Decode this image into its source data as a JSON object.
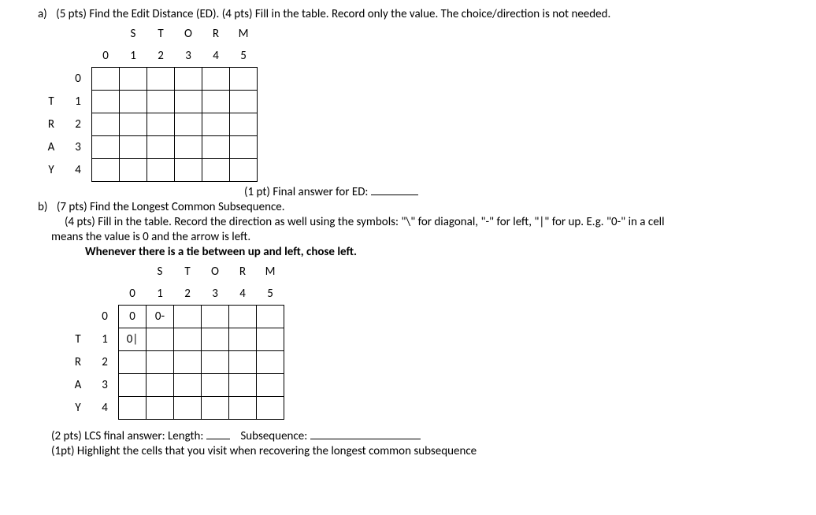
{
  "partA": {
    "label": "a)",
    "prompt": "(5 pts) Find the Edit Distance (ED). (4 pts) Fill in the table. Record only the value. The choice/direction is not needed.",
    "colLetters": [
      "S",
      "T",
      "O",
      "R",
      "M"
    ],
    "colNums": [
      "0",
      "1",
      "2",
      "3",
      "4",
      "5"
    ],
    "rowLetters": [
      "",
      "T",
      "R",
      "A",
      "Y"
    ],
    "rowNums": [
      "0",
      "1",
      "2",
      "3",
      "4"
    ],
    "cells": [
      [
        "",
        "",
        "",
        "",
        "",
        ""
      ],
      [
        "",
        "",
        "",
        "",
        "",
        ""
      ],
      [
        "",
        "",
        "",
        "",
        "",
        ""
      ],
      [
        "",
        "",
        "",
        "",
        "",
        ""
      ],
      [
        "",
        "",
        "",
        "",
        "",
        ""
      ]
    ],
    "finalLabel": "(1 pt) Final answer for ED:"
  },
  "partB": {
    "label": "b)",
    "prompt": "(7 pts) Find the Longest Common Subsequence.",
    "line2a": "(4 pts) Fill in the table. Record the direction as well using the symbols: \"\\\" for diagonal, \"-\" for left, \"|\" for up. E.g. \"0-\" in a cell",
    "line2b": "means the value is 0 and the arrow is left.",
    "rule": "Whenever there is a tie between up and left, chose left.",
    "colLetters": [
      "S",
      "T",
      "O",
      "R",
      "M"
    ],
    "colNums": [
      "0",
      "1",
      "2",
      "3",
      "4",
      "5"
    ],
    "rowLetters": [
      "",
      "T",
      "R",
      "A",
      "Y"
    ],
    "rowNums": [
      "0",
      "1",
      "2",
      "3",
      "4"
    ],
    "cells": [
      [
        "0",
        "0-",
        "",
        "",
        "",
        ""
      ],
      [
        "0|",
        "",
        "",
        "",
        "",
        ""
      ],
      [
        "",
        "",
        "",
        "",
        "",
        ""
      ],
      [
        "",
        "",
        "",
        "",
        "",
        ""
      ],
      [
        "",
        "",
        "",
        "",
        "",
        ""
      ]
    ],
    "lcsLabel1": "(2 pts) LCS final answer: Length:",
    "lcsLabel2": "Subsequence:",
    "highlight": "(1pt) Highlight the cells that you visit when recovering the longest common subsequence"
  }
}
